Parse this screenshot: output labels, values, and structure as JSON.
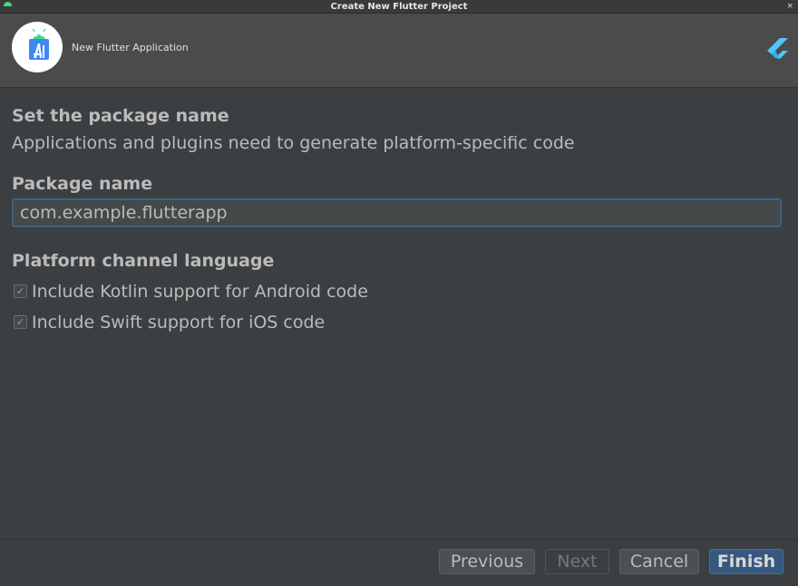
{
  "window": {
    "title": "Create New Flutter Project",
    "close_glyph": "×"
  },
  "header": {
    "app_label": "New Flutter Application",
    "logo_icon": "android-studio-logo-icon",
    "brand_icon": "flutter-logo-icon"
  },
  "main": {
    "heading": "Set the package name",
    "description": "Applications and plugins need to generate platform-specific code",
    "package_label": "Package name",
    "package_value": "com.example.flutterapp",
    "channel_heading": "Platform channel language",
    "options": [
      {
        "label": "Include Kotlin support for Android code",
        "checked": true
      },
      {
        "label": "Include Swift support for iOS code",
        "checked": true
      }
    ]
  },
  "footer": {
    "previous_label": "Previous",
    "next_label": "Next",
    "cancel_label": "Cancel",
    "finish_label": "Finish"
  },
  "colors": {
    "background": "#3c3f41",
    "header": "#4b4b4b",
    "accent": "#365880",
    "focus_border": "#3d6185"
  }
}
